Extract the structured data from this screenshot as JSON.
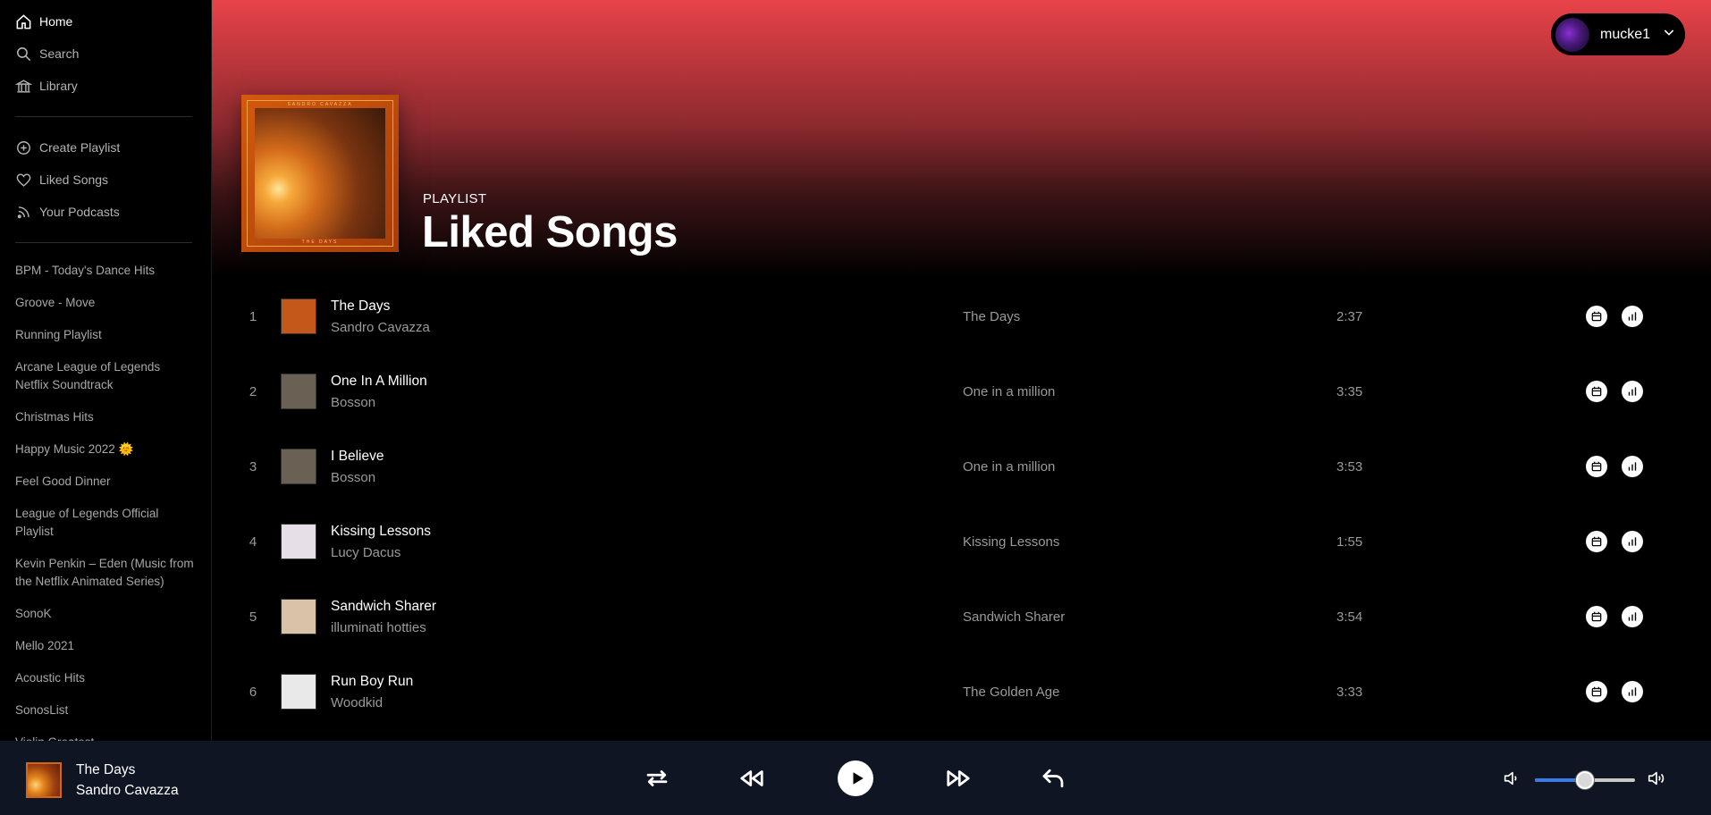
{
  "sidebar": {
    "nav": [
      {
        "label": "Home",
        "icon": "home-icon"
      },
      {
        "label": "Search",
        "icon": "search-icon"
      },
      {
        "label": "Library",
        "icon": "library-icon"
      }
    ],
    "actions": [
      {
        "label": "Create Playlist",
        "icon": "plus-circle-icon"
      },
      {
        "label": "Liked Songs",
        "icon": "heart-icon"
      },
      {
        "label": "Your Podcasts",
        "icon": "rss-icon"
      }
    ],
    "playlists": [
      "BPM - Today's Dance Hits",
      "Groove - Move",
      "Running Playlist",
      "Arcane League of Legends Netflix Soundtrack",
      "Christmas Hits",
      "Happy Music 2022 🌞",
      "Feel Good Dinner",
      "League of Legends Official Playlist",
      "Kevin Penkin – Eden (Music from the Netflix Animated Series)",
      "SonoK",
      "Mello 2021",
      "Acoustic Hits",
      "SonosList",
      "Violin Greatest"
    ]
  },
  "header": {
    "username": "mucke1",
    "gradient_top": "#e9434a"
  },
  "playlist": {
    "type_label": "PLAYLIST",
    "title": "Liked Songs",
    "cover_text_top": "SANDRO CAVAZZA",
    "cover_text_bottom": "THE DAYS"
  },
  "tracks": [
    {
      "num": "1",
      "title": "The Days",
      "artist": "Sandro Cavazza",
      "album": "The Days",
      "duration": "2:37",
      "art": "#c4581a"
    },
    {
      "num": "2",
      "title": "One In A Million",
      "artist": "Bosson",
      "album": "One in a million",
      "duration": "3:35",
      "art": "#6b6054"
    },
    {
      "num": "3",
      "title": "I Believe",
      "artist": "Bosson",
      "album": "One in a million",
      "duration": "3:53",
      "art": "#6b6054"
    },
    {
      "num": "4",
      "title": "Kissing Lessons",
      "artist": "Lucy Dacus",
      "album": "Kissing Lessons",
      "duration": "1:55",
      "art": "#e6dfe8"
    },
    {
      "num": "5",
      "title": "Sandwich Sharer",
      "artist": "illuminati hotties",
      "album": "Sandwich Sharer",
      "duration": "3:54",
      "art": "#d9c3a8"
    },
    {
      "num": "6",
      "title": "Run Boy Run",
      "artist": "Woodkid",
      "album": "The Golden Age",
      "duration": "3:33",
      "art": "#e9e9e9"
    }
  ],
  "player": {
    "now_title": "The Days",
    "now_artist": "Sandro Cavazza",
    "volume_fraction": 0.5,
    "accent": "#3a79e6"
  }
}
